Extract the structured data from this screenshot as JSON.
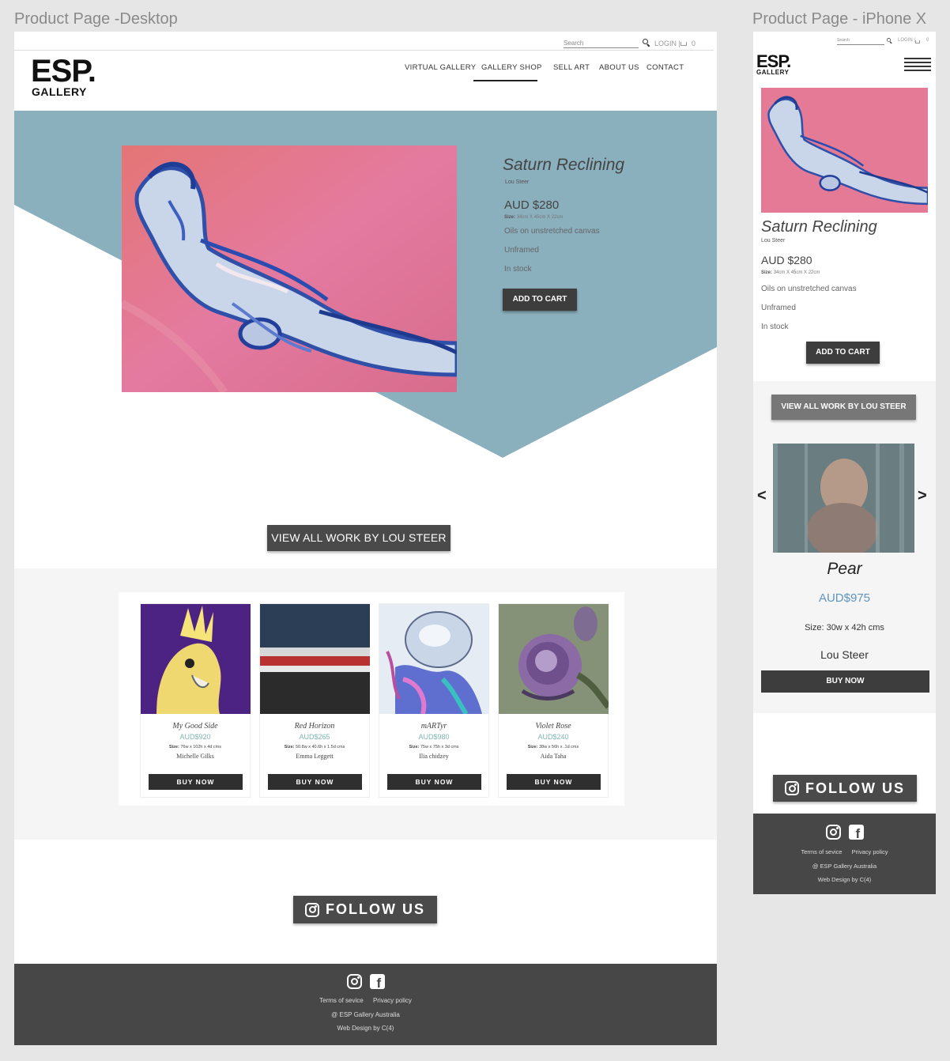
{
  "artboards": {
    "desktop_title": "Product Page -Desktop",
    "mobile_title": "Product Page - iPhone X"
  },
  "topbar": {
    "search_label": "Search",
    "login_label": "LOGIN |",
    "cart_count": "0"
  },
  "logo": {
    "big": "ESP.",
    "small": "GALLERY"
  },
  "nav": {
    "items": [
      "VIRTUAL GALLERY",
      "GALLERY SHOP",
      "SELL ART",
      "ABOUT US",
      "CONTACT"
    ],
    "active": "GALLERY SHOP"
  },
  "product": {
    "title": "Saturn Reclining",
    "artist": "Lou Steer",
    "price": "AUD $280",
    "size_label": "Size:",
    "size_value": "34cm X 45cm X 22cm",
    "medium": "Oils on unstretched canvas",
    "framing": "Unframed",
    "stock": "In stock",
    "add_to_cart": "ADD TO CART"
  },
  "view_all_label": "VIEW ALL WORK BY LOU STEER",
  "related": [
    {
      "name": "My Good Side",
      "price": "AUD$920",
      "size_label": "Size:",
      "size": "76w x 102h x 4d cms",
      "artist": "Michelle Gilks",
      "buy": "BUY NOW"
    },
    {
      "name": "Red Horizon",
      "price": "AUD$265",
      "size_label": "Size:",
      "size": "50.8w x 40.6h x 1.5d cms",
      "artist": "Emma Leggett",
      "buy": "BUY NOW"
    },
    {
      "name": "mARTyr",
      "price": "AUD$980",
      "size_label": "Size:",
      "size": "75w x 75h x 3d cms",
      "artist": "Ilia chidzey",
      "buy": "BUY NOW"
    },
    {
      "name": "Violet Rose",
      "price": "AUD$240",
      "size_label": "Size:",
      "size": "38w x 56h x .1d cms",
      "artist": "Aida Taha",
      "buy": "BUY NOW"
    }
  ],
  "follow_label": "FOLLOW US",
  "footer": {
    "terms": "Terms of sevice",
    "privacy": "Privacy policy",
    "copyright": "@ ESP Gallery Australia",
    "credit": "Web Design by C(4)"
  },
  "mobile_carousel": {
    "prev": "<",
    "next": ">",
    "name": "Pear",
    "price": "AUD$975",
    "size": "Size: 30w x 42h cms",
    "artist": "Lou Steer",
    "buy": "BUY NOW"
  },
  "colors": {
    "hero_blue": "#8aafbd",
    "dark_button": "#3d3d3d",
    "footer_bg": "#474747",
    "price_teal": "#7fb5b0",
    "price_blue": "#5e94c0"
  }
}
